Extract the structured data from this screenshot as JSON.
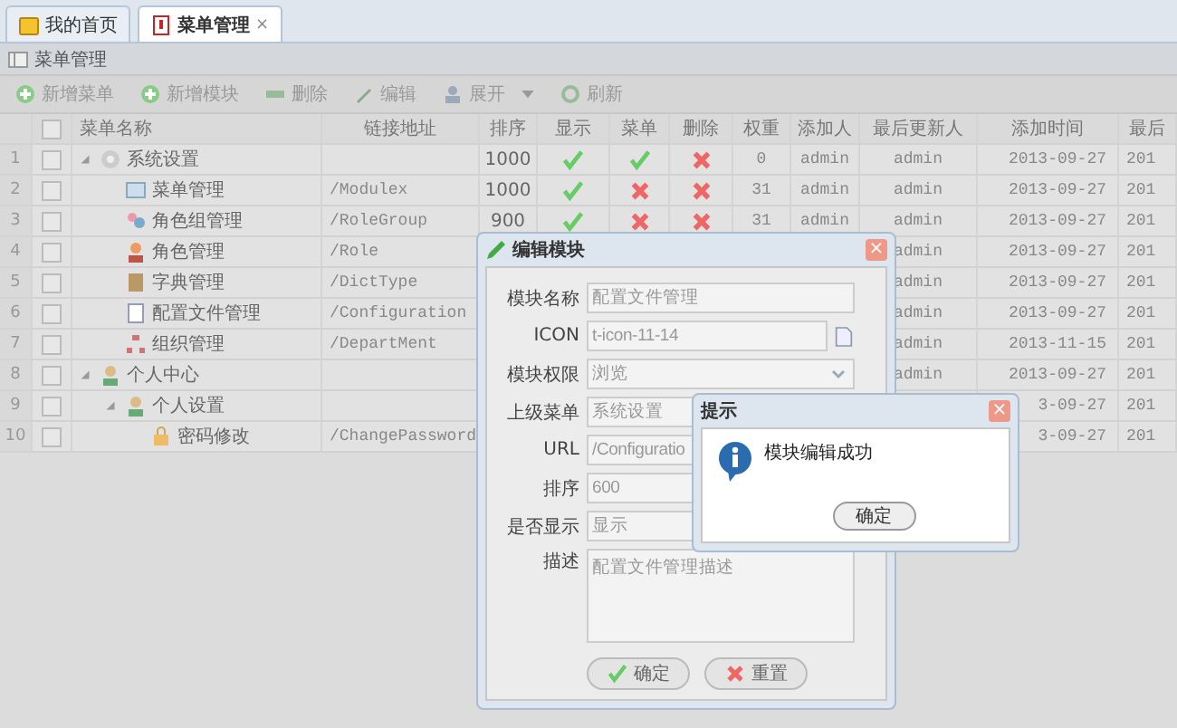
{
  "tabs": [
    {
      "label": "我的首页",
      "kind": "home",
      "selected": false
    },
    {
      "label": "菜单管理",
      "kind": "menu",
      "selected": true,
      "close": "×"
    }
  ],
  "panel": {
    "title": "菜单管理"
  },
  "toolbar": [
    {
      "label": "新增菜单",
      "kind": "add"
    },
    {
      "label": "新增模块",
      "kind": "add"
    },
    {
      "label": "删除",
      "kind": "remove"
    },
    {
      "label": "编辑",
      "kind": "edit"
    },
    {
      "label": "展开",
      "kind": "expand",
      "dropdown": true
    },
    {
      "label": "刷新",
      "kind": "refresh"
    }
  ],
  "table": {
    "header_checked": false,
    "columns": [
      "菜单名称",
      "链接地址",
      "排序",
      "显示",
      "菜单",
      "删除",
      "权重",
      "添加人",
      "最后更新人",
      "添加时间",
      "最后"
    ],
    "rows": [
      {
        "number": "1",
        "checked": false,
        "name": "系统设置",
        "kind": "settings",
        "expanded": true,
        "sort": "1000",
        "shown": true,
        "menu": true,
        "deletable": false,
        "weight": "0",
        "adder": "admin",
        "updater": "admin",
        "added": "2013-09-27",
        "last": "201",
        "children": [
          {
            "number": "2",
            "checked": false,
            "name": "菜单管理",
            "kind": "module",
            "url": "/Modulex",
            "sort": "1000",
            "shown": true,
            "menu": false,
            "deletable": false,
            "weight": "31",
            "adder": "admin",
            "updater": "admin",
            "added": "2013-09-27",
            "last": "201"
          },
          {
            "number": "3",
            "checked": false,
            "name": "角色组管理",
            "kind": "group",
            "url": "/RoleGroup",
            "sort": "900",
            "shown": true,
            "menu": false,
            "deletable": false,
            "weight": "31",
            "adder": "admin",
            "updater": "admin",
            "added": "2013-09-27",
            "last": "201"
          },
          {
            "number": "4",
            "checked": false,
            "name": "角色管理",
            "kind": "person",
            "url": "/Role",
            "updater": "admin",
            "added": "2013-09-27",
            "last": "201"
          },
          {
            "number": "5",
            "checked": false,
            "name": "字典管理",
            "kind": "book",
            "url": "/DictType",
            "updater": "admin",
            "added": "2013-09-27",
            "last": "201"
          },
          {
            "number": "6",
            "checked": false,
            "name": "配置文件管理",
            "kind": "document",
            "url": "/Configuration",
            "updater": "admin",
            "added": "2013-09-27",
            "last": "201"
          },
          {
            "number": "7",
            "checked": false,
            "name": "组织管理",
            "kind": "organization",
            "url": "/DepartMent",
            "updater": "admin",
            "added": "2013-11-15",
            "last": "201"
          }
        ]
      },
      {
        "number": "8",
        "checked": false,
        "name": "个人中心",
        "kind": "user",
        "expanded": true,
        "updater": "admin",
        "added": "2013-09-27",
        "last": "201",
        "children": [
          {
            "number": "9",
            "checked": false,
            "name": "个人设置",
            "kind": "users",
            "expanded": true,
            "added": "3-09-27",
            "last": "201",
            "children": [
              {
                "number": "10",
                "checked": false,
                "name": "密码修改",
                "kind": "lock",
                "url": "/ChangePassword",
                "added": "3-09-27",
                "last": "201"
              }
            ]
          }
        ]
      }
    ]
  },
  "edit_dialog": {
    "title": "编辑模块",
    "close": "×",
    "fields": [
      {
        "label": "模块名称",
        "kind": "text",
        "value": "配置文件管理"
      },
      {
        "label": "ICON",
        "kind": "icon",
        "value": "t-icon-11-14"
      },
      {
        "label": "模块权限",
        "kind": "select",
        "value": "浏览",
        "arrow": true
      },
      {
        "label": "上级菜单",
        "kind": "text",
        "value": "系统设置"
      },
      {
        "label": "URL",
        "kind": "text",
        "value": "/Configuratio"
      },
      {
        "label": "排序",
        "kind": "text",
        "value": "600"
      },
      {
        "label": "是否显示",
        "kind": "select",
        "value": "显示"
      },
      {
        "label": "描述",
        "kind": "textarea",
        "value": "配置文件管理描述"
      }
    ],
    "buttons": [
      {
        "label": "确定",
        "kind": "ok"
      },
      {
        "label": "重置",
        "kind": "reset"
      }
    ]
  },
  "alert": {
    "title": "提示",
    "close": "×",
    "message": "模块编辑成功",
    "button": "确定"
  }
}
